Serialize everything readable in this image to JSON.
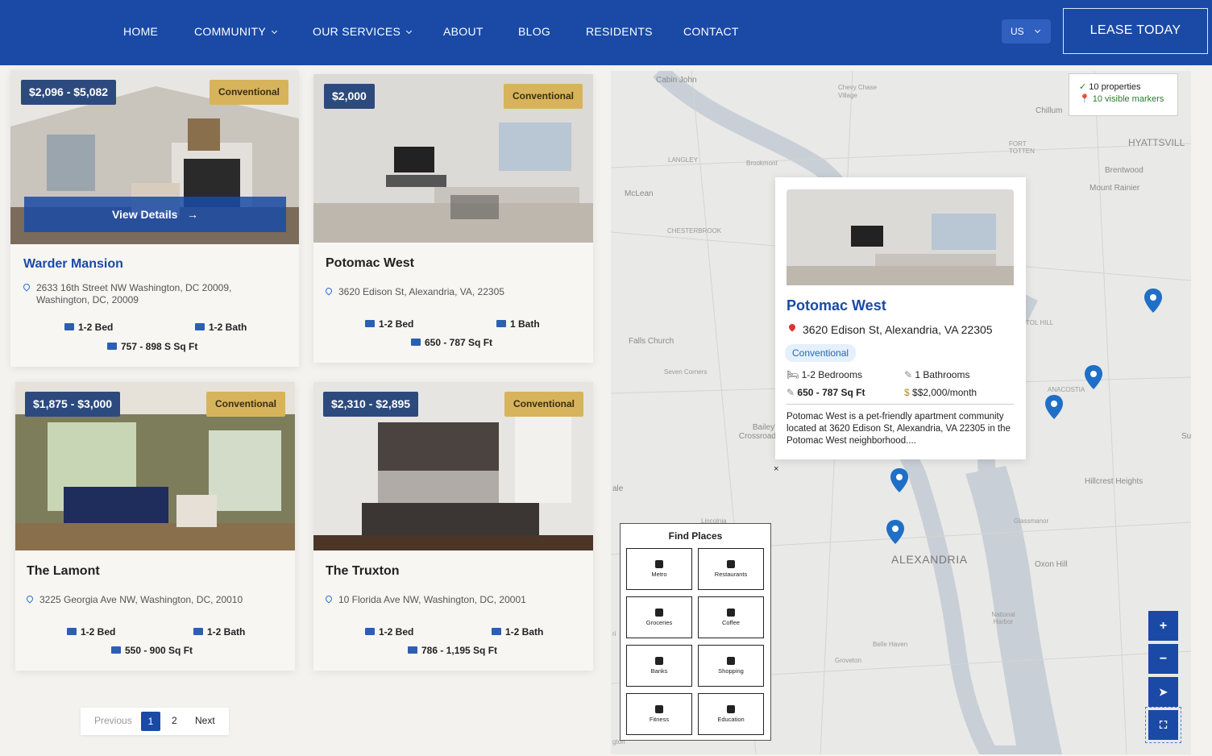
{
  "nav": {
    "items": [
      "HOME",
      "COMMUNITY",
      "OUR SERVICES",
      "ABOUT",
      "BLOG",
      "RESIDENTS",
      "CONTACT"
    ],
    "lang": "US",
    "lease": "LEASE TODAY"
  },
  "colors": {
    "brand": "#1a4aa6",
    "badge": "#d7b45c",
    "price": "#2c4a7d"
  },
  "cards": [
    {
      "price": "$2,096 - $5,082",
      "badge": "Conventional",
      "name": "Warder Mansion",
      "address": "2633 16th Street NW Washington, DC 20009, Washington, DC, 20009",
      "bed": "1-2 Bed",
      "bath": "1-2 Bath",
      "sqft": "757 - 898 S Sq Ft",
      "view": "View Details"
    },
    {
      "price": "$2,000",
      "badge": "Conventional",
      "name": "Potomac West",
      "address": "3620 Edison St, Alexandria, VA, 22305",
      "bed": "1-2 Bed",
      "bath": "1 Bath",
      "sqft": "650 - 787 Sq Ft"
    },
    {
      "price": "$1,875 - $3,000",
      "badge": "Conventional",
      "name": "The Lamont",
      "address": "3225 Georgia Ave NW, Washington, DC, 20010",
      "bed": "1-2 Bed",
      "bath": "1-2 Bath",
      "sqft": "550 - 900 Sq Ft"
    },
    {
      "price": "$2,310 - $2,895",
      "badge": "Conventional",
      "name": "The Truxton",
      "address": "10 Florida Ave NW, Washington, DC, 20001",
      "bed": "1-2 Bed",
      "bath": "1-2 Bath",
      "sqft": "786 - 1,195 Sq Ft"
    }
  ],
  "pager": {
    "prev": "Previous",
    "p1": "1",
    "p2": "2",
    "next": "Next"
  },
  "legend": {
    "props": "10 properties",
    "markers": "10 visible markers"
  },
  "map_labels": [
    "Cabin John",
    "Chevy Chase Village",
    "Chillum",
    "FORT TOTTEN",
    "HYATTSVILL",
    "Brentwood",
    "Mount Rainier",
    "LANGLEY",
    "Brookmont",
    "McLean",
    "CHESTERBROOK",
    "TOL HILL",
    "Falls Church",
    "Seven Corners",
    "ANACOSTIA",
    "Bailey's Crossroads",
    "Su",
    "ale",
    "Hillcrest Heights",
    "Glassmanor",
    "Lincolnia",
    "ALEXANDRIA",
    "Oxon Hill",
    "National Harbor",
    "Belle Haven",
    "Groveton",
    "gton",
    "ri"
  ],
  "popup": {
    "name": "Potomac West",
    "address": "3620 Edison St, Alexandria, VA 22305",
    "tag": "Conventional",
    "bedrooms": "1-2 Bedrooms",
    "bathrooms": "1 Bathrooms",
    "sqft": "650 - 787 Sq Ft",
    "rent": "$$2,000/month",
    "description": "Potomac West is a pet-friendly apartment community located at 3620 Edison St, Alexandria, VA 22305 in the Potomac West neighborhood....",
    "close": "×"
  },
  "find": {
    "title": "Find Places",
    "buttons": [
      "Metro",
      "Restaurants",
      "Groceries",
      "Coffee",
      "Banks",
      "Shopping",
      "Fitness",
      "Education"
    ]
  },
  "controls": {
    "zoom_in": "+",
    "zoom_out": "−",
    "locate": "➤",
    "fullscreen": "⛶"
  }
}
